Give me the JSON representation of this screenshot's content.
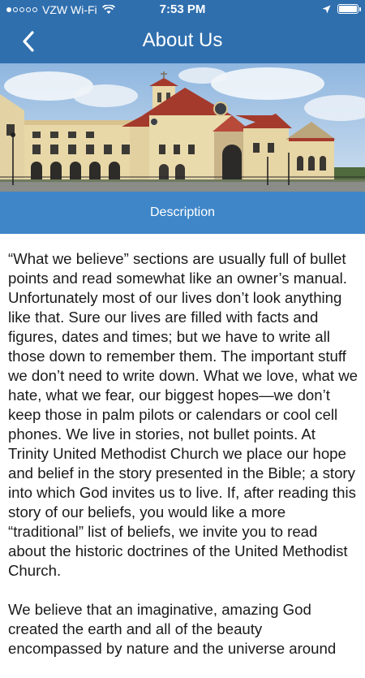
{
  "status": {
    "carrier": "VZW Wi-Fi",
    "time": "7:53 PM",
    "signal_dots_filled": 1,
    "signal_dots_total": 5
  },
  "nav": {
    "title": "About Us",
    "back_icon": "chevron-left-icon"
  },
  "hero": {
    "image": "church-building-photo"
  },
  "section": {
    "label": "Description"
  },
  "body": {
    "paragraph_1": "“What we believe” sections are usually full of bullet points and read somewhat like an owner’s manual.  Unfortunately most of our lives don’t look anything like that.  Sure our lives are filled with facts and figures, dates and times; but we have to write all those down to remember them.  The important stuff we don’t need to write down.  What we love, what we hate, what we fear, our biggest hopes—we don’t keep those in palm pilots or calendars or cool cell phones.  We live in stories, not bullet points.  At Trinity United Methodist Church we place our hope and belief in the story presented in the Bible; a story into which God invites us to live.  If, after reading this story of our beliefs, you would like a more “traditional” list of beliefs, we invite you to read about the historic doctrines of the United Methodist Church.",
    "paragraph_2": "We believe that an imaginative, amazing God created the earth and all of the beauty encompassed by nature and the universe around"
  },
  "colors": {
    "header": "#2f6fae",
    "section_bar": "#3e86c8",
    "text": "#1a1a1a"
  }
}
